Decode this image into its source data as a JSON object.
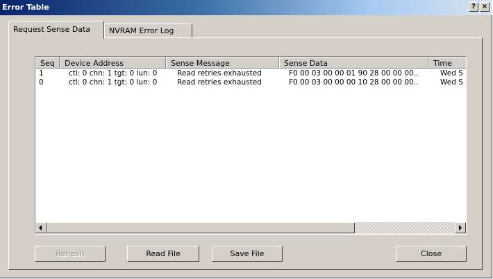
{
  "window": {
    "title": "Error Table",
    "help_glyph": "?",
    "close_glyph": "×"
  },
  "tabs": [
    {
      "label": "Request Sense Data",
      "active": true
    },
    {
      "label": "NVRAM Error Log",
      "active": false
    }
  ],
  "table": {
    "columns": [
      "Seq",
      "Device Address",
      "Sense Message",
      "Sense Data",
      "Time"
    ],
    "rows": [
      [
        "1",
        "ctl: 0 chn: 1 tgt: 0 lun: 0",
        "Read retries exhausted",
        "F0 00 03 00 00 01 90 28 00 00 00..",
        "Wed S"
      ],
      [
        "0",
        "ctl: 0 chn: 1 tgt: 0 lun: 0",
        "Read retries exhausted",
        "F0 00 03 00 00 00 10 28 00 00 00..",
        "Wed S"
      ]
    ]
  },
  "buttons": {
    "refresh": "Refresh",
    "read_file": "Read File",
    "save_file": "Save File",
    "close": "Close"
  },
  "colors": {
    "face": "#d4d0c8",
    "title_start": "#0a246a",
    "title_end": "#d8e4f0"
  }
}
